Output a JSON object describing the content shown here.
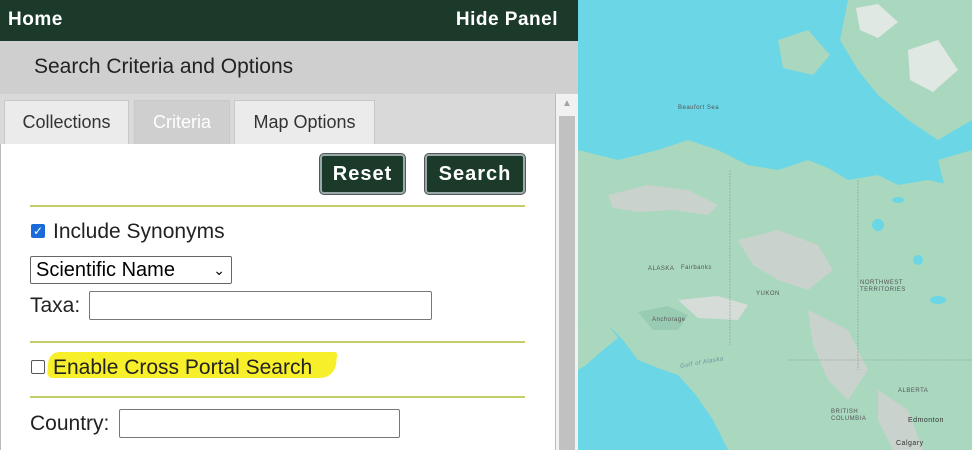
{
  "topbar": {
    "home": "Home",
    "hide_panel": "Hide Panel"
  },
  "panel_title": "Search Criteria and Options",
  "tabs": [
    {
      "label": "Collections",
      "active": false
    },
    {
      "label": "Criteria",
      "active": true
    },
    {
      "label": "Map Options",
      "active": false
    }
  ],
  "buttons": {
    "reset": "Reset",
    "search": "Search"
  },
  "criteria": {
    "include_synonyms": {
      "label": "Include Synonyms",
      "checked": true
    },
    "taxon_type_select": {
      "selected": "Scientific Name"
    },
    "taxa": {
      "label": "Taxa:",
      "value": ""
    },
    "cross_portal": {
      "label": "Enable Cross Portal Search",
      "checked": false
    },
    "country": {
      "label": "Country:",
      "value": ""
    }
  },
  "map": {
    "labels": {
      "beaufort_sea": "Beaufort Sea",
      "alaska": "ALASKA",
      "fairbanks": "Fairbanks",
      "yukon": "YUKON",
      "northwest_territories": "NORTHWEST TERRITORIES",
      "anchorage": "Anchorage",
      "gulf_of_alaska": "Gulf of Alaska",
      "alberta": "ALBERTA",
      "british_columbia": "BRITISH COLUMBIA",
      "edmonton": "Edmonton",
      "calgary": "Calgary"
    }
  },
  "colors": {
    "header_green": "#1b3a2a",
    "divider_olive": "#c5cf6a",
    "highlight_yellow": "#f7ef2a",
    "map_water": "#6ad6e6",
    "map_land": "#a9d8bf"
  }
}
